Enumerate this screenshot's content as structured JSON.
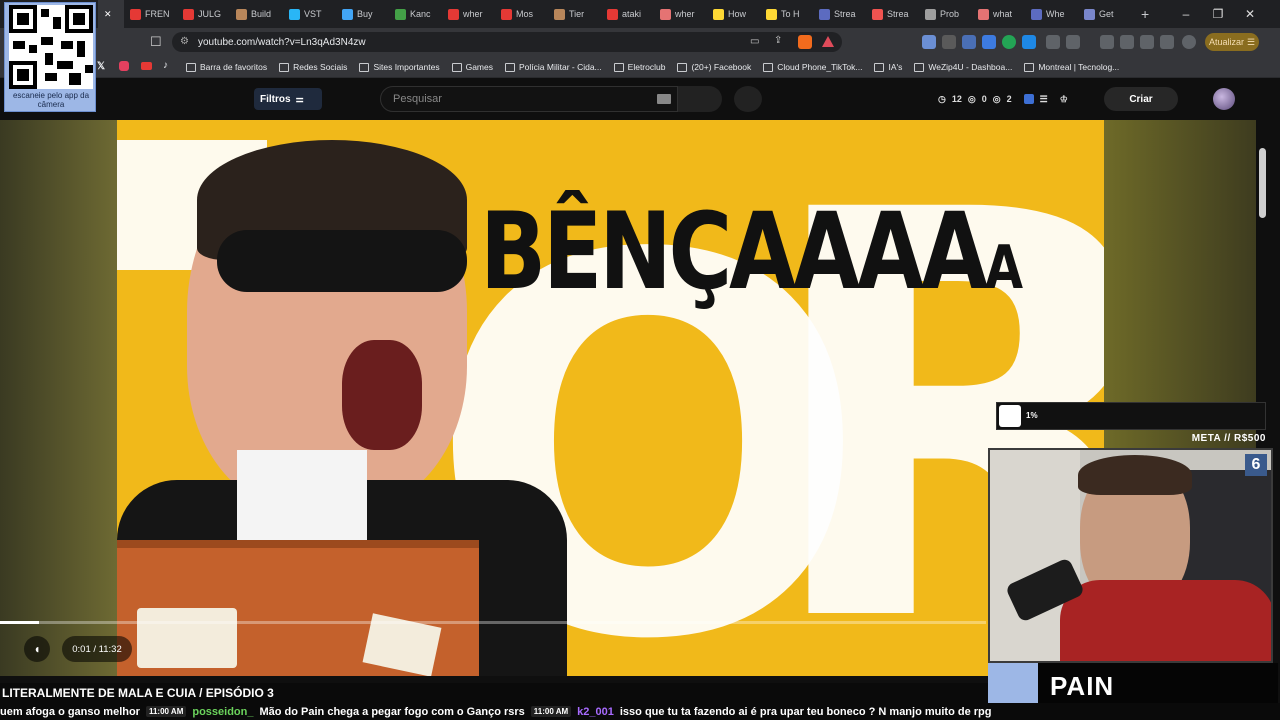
{
  "browser": {
    "tabs": [
      {
        "label": "FREN",
        "color": "#e53935"
      },
      {
        "label": "JULG",
        "color": "#e53935"
      },
      {
        "label": "Build",
        "color": "#b8865a"
      },
      {
        "label": "VST",
        "color": "#29b6f6"
      },
      {
        "label": "Buy",
        "color": "#42a5f5"
      },
      {
        "label": "Kanc",
        "color": "#43a047"
      },
      {
        "label": "wher",
        "color": "#e53935"
      },
      {
        "label": "Mos",
        "color": "#e53935"
      },
      {
        "label": "Tier",
        "color": "#b8865a"
      },
      {
        "label": "ataki",
        "color": "#e53935"
      },
      {
        "label": "wher",
        "color": "#e57373"
      },
      {
        "label": "How",
        "color": "#fdd835"
      },
      {
        "label": "To H",
        "color": "#fdd835"
      },
      {
        "label": "Strea",
        "color": "#5c6bc0"
      },
      {
        "label": "Strea",
        "color": "#ef5350"
      },
      {
        "label": "Prob",
        "color": "#9e9e9e"
      },
      {
        "label": "what",
        "color": "#e57373"
      },
      {
        "label": "Whe",
        "color": "#5c6bc0"
      },
      {
        "label": "Get",
        "color": "#7986cb"
      }
    ],
    "new_tab": "+",
    "window_controls": {
      "minimize": "–",
      "restore": "❐",
      "close": "✕"
    },
    "url": "youtube.com/watch?v=Ln3qAd3N4zw",
    "update_label": "Atualizar",
    "bookmarks": [
      "Barra de favoritos",
      "Redes Sociais",
      "Sites Importantes",
      "Games",
      "Polícia Militar - Cida...",
      "Eletroclub",
      "(20+) Facebook",
      "Cloud Phone_TikTok...",
      "IA's",
      "WeZip4U - Dashboa...",
      "Montreal | Tecnolog..."
    ]
  },
  "qr_overlay": {
    "caption": "escaneie pelo app da câmera"
  },
  "youtube": {
    "filters_label": "Filtros",
    "search_placeholder": "Pesquisar",
    "stats": {
      "a": "12",
      "b": "0",
      "c": "2"
    },
    "create_label": "Criar"
  },
  "video": {
    "thumbnail_text": "BÊNÇAAAA",
    "thumbnail_text_small": "A",
    "progress_fraction": 0.04,
    "time": "0:01 / 11:32"
  },
  "stream_overlay": {
    "goal_percent": "1%",
    "goal_label": "META // R$500",
    "cam_badge": "6",
    "streamer_name": "PAIN",
    "episode_title": "LITERALMENTE DE MALA E CUIA / EPISÓDIO 3"
  },
  "chat_ticker": [
    {
      "time": "",
      "user": "",
      "text": "uem afoga o ganso melhor"
    },
    {
      "time": "11:00 AM",
      "user": "posseidon_",
      "text": "Mão do Pain chega a pegar fogo com o Ganço rsrs"
    },
    {
      "time": "11:00 AM",
      "user": "k2_001",
      "text": "isso que tu ta fazendo ai é pra upar teu boneco ? N manjo muito de rpg"
    }
  ]
}
